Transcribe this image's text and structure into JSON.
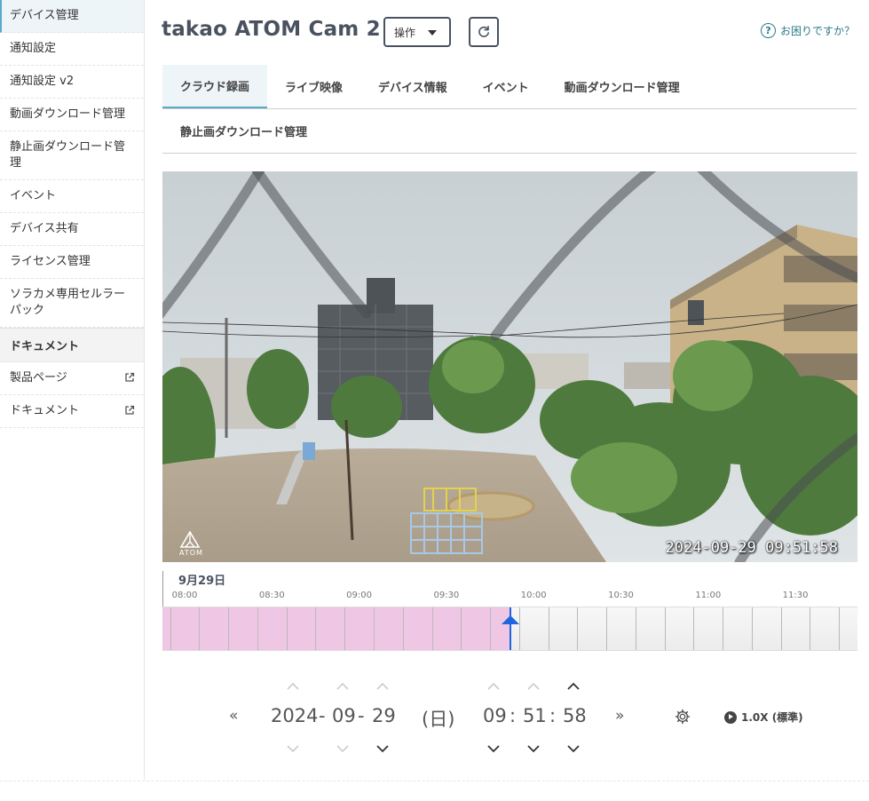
{
  "sidebar": {
    "items": [
      {
        "label": "デバイス管理"
      },
      {
        "label": "通知設定"
      },
      {
        "label": "通知設定 v2"
      },
      {
        "label": "動画ダウンロード管理"
      },
      {
        "label": "静止画ダウンロード管理"
      },
      {
        "label": "イベント"
      },
      {
        "label": "デバイス共有"
      },
      {
        "label": "ライセンス管理"
      },
      {
        "label": "ソラカメ専用セルラーパック"
      }
    ],
    "section_title": "ドキュメント",
    "links": [
      {
        "label": "製品ページ"
      },
      {
        "label": "ドキュメント"
      }
    ]
  },
  "header": {
    "title": "takao ATOM Cam 2",
    "operation_label": "操作",
    "help_label": "お困りですか？",
    "help_glyph": "?"
  },
  "tabs": {
    "row1": [
      "クラウド録画",
      "ライブ映像",
      "デバイス情報",
      "イベント",
      "動画ダウンロード管理"
    ],
    "row2": [
      "静止画ダウンロード管理"
    ]
  },
  "video": {
    "timestamp": "2024-09-29  09:51:58",
    "logo_text": "ATOM"
  },
  "timeline": {
    "day_label": "9月29日",
    "ticks": [
      "08:00",
      "08:30",
      "09:00",
      "09:30",
      "10:00",
      "10:30",
      "11:00",
      "11:30"
    ],
    "recorded_until": "09:51:58"
  },
  "controls": {
    "prev": "«",
    "next": "»",
    "year": "2024",
    "month": "09",
    "day": "29",
    "date_sep": "-",
    "weekday": "(日)",
    "hour": "09",
    "minute": "51",
    "second": "58",
    "time_sep": ":",
    "speed_label": "1.0X (標準)"
  },
  "colors": {
    "accent": "#5aa9c9",
    "recorded": "#efc6e3",
    "cursor": "#1c66e0",
    "help": "#2c7a8c"
  }
}
